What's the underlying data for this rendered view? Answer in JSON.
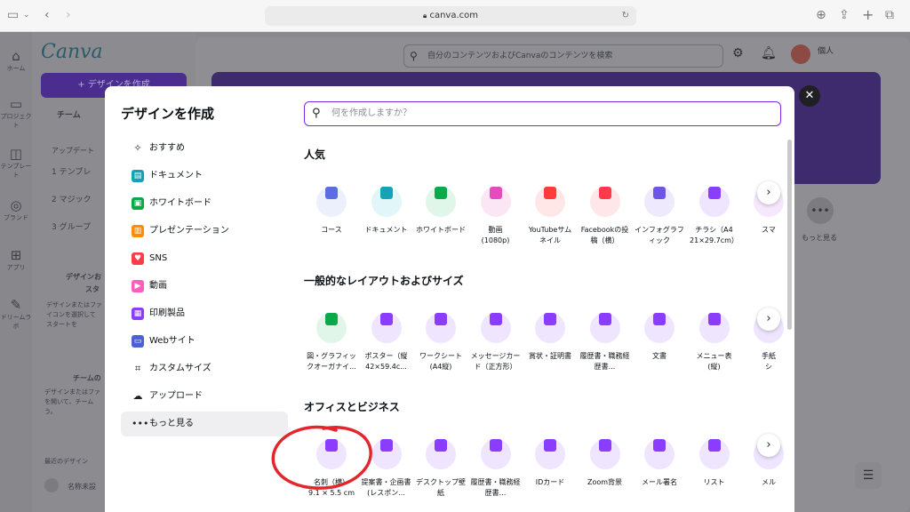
{
  "browser": {
    "url": "canva.com"
  },
  "app": {
    "rail": [
      {
        "label": "ホーム"
      },
      {
        "label": "プロジェクト"
      },
      {
        "label": "テンプレート"
      },
      {
        "label": "ブランド"
      },
      {
        "label": "アプリ"
      },
      {
        "label": "ドリームラボ"
      }
    ],
    "logo": "Canva",
    "create_button": "+ デザインを作成",
    "team_label": "チーム",
    "update_label": "アップデート",
    "steps": [
      "1 テンプレ",
      "2 マジック",
      "3 グループ"
    ],
    "side_heading": "デザインお",
    "side_sub": "スタ",
    "side_desc": "デザインまたはファ\nイコンを選択して\nスタートを",
    "team_heading": "チームの",
    "team_desc": "デザインまたはファ\nを開いて、チーム\nう。",
    "recent_heading": "最近のデザイン",
    "recent_item": "名称未設",
    "search_placeholder": "自分のコンテンツおよびCanvaのコンテンツを検索",
    "user_name": "個人",
    "more_label": "もっと見る"
  },
  "modal": {
    "title": "デザインを作成",
    "search_placeholder": "何を作成しますか？",
    "categories": [
      {
        "label": "おすすめ",
        "icon": "sparkle-icon",
        "color": "#222222"
      },
      {
        "label": "ドキュメント",
        "icon": "doc-icon",
        "color": "#13a3b5"
      },
      {
        "label": "ホワイトボード",
        "icon": "whiteboard-icon",
        "color": "#0ba84a"
      },
      {
        "label": "プレゼンテーション",
        "icon": "presentation-icon",
        "color": "#ff8b00"
      },
      {
        "label": "SNS",
        "icon": "heart-icon",
        "color": "#ff3b4b"
      },
      {
        "label": "動画",
        "icon": "video-icon",
        "color": "#ff5dbb"
      },
      {
        "label": "印刷製品",
        "icon": "print-icon",
        "color": "#8b3dff"
      },
      {
        "label": "Webサイト",
        "icon": "web-icon",
        "color": "#4a61d8"
      },
      {
        "label": "カスタムサイズ",
        "icon": "crop-icon",
        "color": "#222222"
      },
      {
        "label": "アップロード",
        "icon": "cloud-upload-icon",
        "color": "#222222"
      },
      {
        "label": "もっと見る",
        "icon": "more-icon",
        "color": "#222222"
      }
    ],
    "sections": [
      {
        "title": "人気",
        "items": [
          {
            "label": "コース",
            "color": "#5b6ee1",
            "bg": "#eceffc"
          },
          {
            "label": "ドキュメント",
            "color": "#13a3b5",
            "bg": "#e0f6f8"
          },
          {
            "label": "ホワイトボード",
            "color": "#0ba84a",
            "bg": "#e0f6e8"
          },
          {
            "label": "動画\n(1080p)",
            "color": "#e64bbd",
            "bg": "#fbe6f5"
          },
          {
            "label": "YouTubeサム\nネイル",
            "color": "#ff3b3b",
            "bg": "#ffe7e7"
          },
          {
            "label": "Facebookの投\n稿（横）",
            "color": "#ff3b4b",
            "bg": "#ffe6e8"
          },
          {
            "label": "インフォグラフ\nィック",
            "color": "#6f55e6",
            "bg": "#eee9fd"
          },
          {
            "label": "チラシ（A4\n21×29.7cm）",
            "color": "#8b3dff",
            "bg": "#efe5ff"
          },
          {
            "label": "スマ",
            "color": "#b050e0",
            "bg": "#f6e8fc"
          }
        ]
      },
      {
        "title": "一般的なレイアウトおよびサイズ",
        "items": [
          {
            "label": "図・グラフィッ\nクオーガナイ...",
            "color": "#0ba84a",
            "bg": "#e0f6e8"
          },
          {
            "label": "ポスター（縦\n42×59.4c...",
            "color": "#8b3dff",
            "bg": "#efe5ff"
          },
          {
            "label": "ワークシート\n(A4縦)",
            "color": "#8b3dff",
            "bg": "#efe5ff"
          },
          {
            "label": "メッセージカー\nド（正方形）",
            "color": "#8b3dff",
            "bg": "#efe5ff"
          },
          {
            "label": "賞状・証明書",
            "color": "#8b3dff",
            "bg": "#efe5ff"
          },
          {
            "label": "履歴書・職務経\n歴書...",
            "color": "#8b3dff",
            "bg": "#efe5ff"
          },
          {
            "label": "文書",
            "color": "#8b3dff",
            "bg": "#efe5ff"
          },
          {
            "label": "メニュー表\n(縦)",
            "color": "#8b3dff",
            "bg": "#efe5ff"
          },
          {
            "label": "手紙\nシ",
            "color": "#8b3dff",
            "bg": "#efe5ff"
          }
        ]
      },
      {
        "title": "オフィスとビジネス",
        "items": [
          {
            "label": "名刺（横）\n9.1 × 5.5 cm",
            "color": "#8b3dff",
            "bg": "#efe5ff"
          },
          {
            "label": "提案書・企画書\n(レスポン...",
            "color": "#8b3dff",
            "bg": "#efe5ff"
          },
          {
            "label": "デスクトップ壁\n紙",
            "color": "#8b3dff",
            "bg": "#efe5ff"
          },
          {
            "label": "履歴書・職務経\n歴書...",
            "color": "#8b3dff",
            "bg": "#efe5ff"
          },
          {
            "label": "IDカード",
            "color": "#8b3dff",
            "bg": "#efe5ff"
          },
          {
            "label": "Zoom背景",
            "color": "#8b3dff",
            "bg": "#efe5ff"
          },
          {
            "label": "メール署名",
            "color": "#8b3dff",
            "bg": "#efe5ff"
          },
          {
            "label": "リスト",
            "color": "#8b3dff",
            "bg": "#efe5ff"
          },
          {
            "label": "メル",
            "color": "#8b3dff",
            "bg": "#efe5ff"
          }
        ]
      }
    ]
  }
}
